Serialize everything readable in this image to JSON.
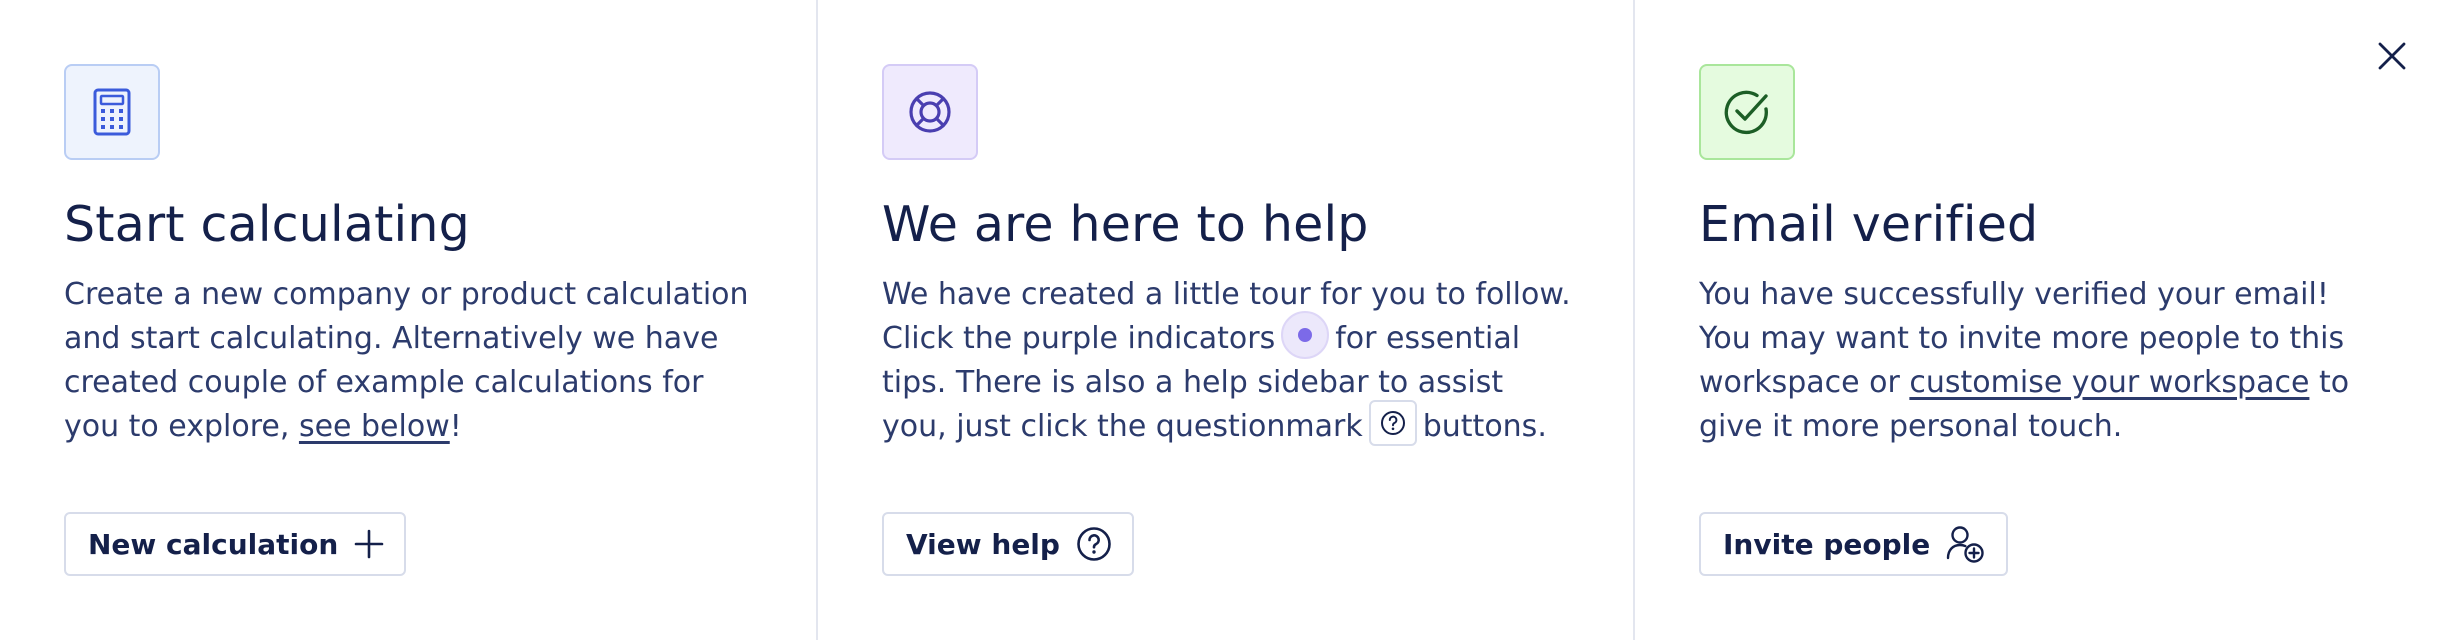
{
  "close": {
    "icon": "close-icon"
  },
  "cards": [
    {
      "icon": "calculator-icon",
      "title": "Start calculating",
      "desc_before": "Create a new company or product calculation and start calculating. Alternatively we have created couple of example calculations for you to explore, ",
      "desc_link": "see below",
      "desc_after": "!",
      "button_label": "New calculation",
      "button_icon": "plus-icon"
    },
    {
      "icon": "lifebuoy-icon",
      "title": "We are here to help",
      "desc_1": "We have created a little tour for you to follow. Click the purple indicators",
      "desc_2": "for essential tips. There is also a help sidebar to assist you, just click the questionmark",
      "desc_3": "buttons.",
      "button_label": "View help",
      "button_icon": "help-circle-icon"
    },
    {
      "icon": "check-circle-icon",
      "title": "Email verified",
      "desc_before": "You have successfully verified your email! You may want to invite more people to this workspace or ",
      "desc_link": "customise your workspace",
      "desc_after": " to give it more personal touch.",
      "button_label": "Invite people",
      "button_icon": "user-plus-icon"
    }
  ],
  "colors": {
    "text": "#14204a",
    "blue_accent": "#3b5bdb",
    "purple_accent": "#4a3fb0",
    "green_accent": "#1c5e26",
    "indicator": "#7c6ae8"
  }
}
